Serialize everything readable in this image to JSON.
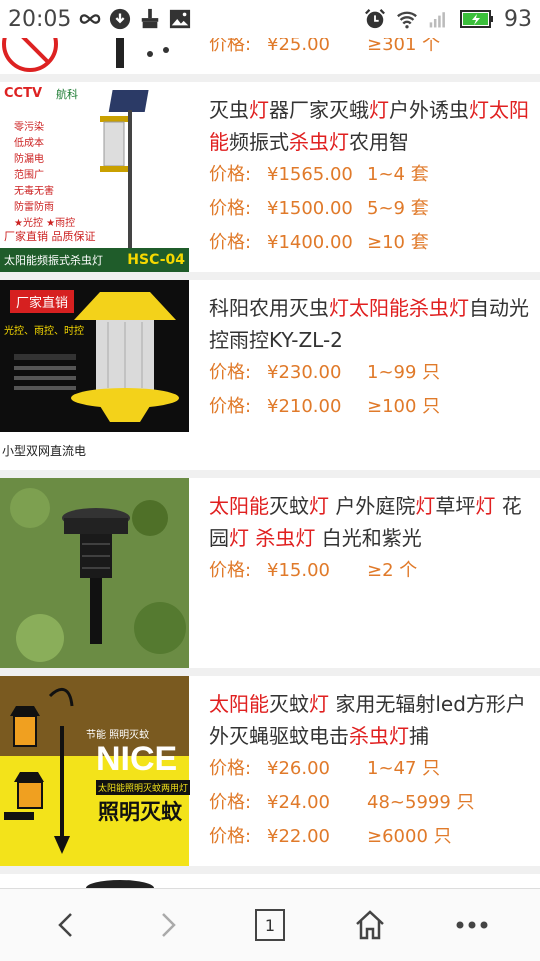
{
  "status": {
    "time": "20:05",
    "battery": "93"
  },
  "items": [
    {
      "title_parts": [],
      "prices": [
        {
          "label": "价格:",
          "amount": "¥25.00",
          "qty": "≥301 个"
        }
      ],
      "thumb_caption": ""
    },
    {
      "title_parts": [
        {
          "t": "灭虫",
          "hl": false
        },
        {
          "t": "灯",
          "hl": true
        },
        {
          "t": "器厂家灭蛾",
          "hl": false
        },
        {
          "t": "灯",
          "hl": true
        },
        {
          "t": "户外诱虫",
          "hl": false
        },
        {
          "t": "灯太阳能",
          "hl": true
        },
        {
          "t": "频振式",
          "hl": false
        },
        {
          "t": "杀虫灯",
          "hl": true
        },
        {
          "t": "农用智",
          "hl": false
        }
      ],
      "prices": [
        {
          "label": "价格:",
          "amount": "¥1565.00",
          "qty": "1~4 套"
        },
        {
          "label": "价格:",
          "amount": "¥1500.00",
          "qty": "5~9 套"
        },
        {
          "label": "价格:",
          "amount": "¥1400.00",
          "qty": "≥10 套"
        }
      ],
      "thumb_brand": "CCTV",
      "thumb_brand2": "航科",
      "thumb_caption": "太阳能频振式杀虫灯",
      "thumb_model": "HSC-04",
      "thumb_bottom": "厂家直销 品质保证",
      "thumb_features": [
        "零污染",
        "低成本",
        "防漏电",
        "范围广",
        "无毒无害",
        "防雷防雨",
        "★光控 ★雨控"
      ]
    },
    {
      "title_parts": [
        {
          "t": "科阳农用灭虫",
          "hl": false
        },
        {
          "t": "灯太阳能杀虫灯",
          "hl": true
        },
        {
          "t": "自动光控雨控KY-ZL-2",
          "hl": false
        }
      ],
      "prices": [
        {
          "label": "价格:",
          "amount": "¥230.00",
          "qty": "1~99 只"
        },
        {
          "label": "价格:",
          "amount": "¥210.00",
          "qty": "≥100 只"
        }
      ],
      "thumb_badge": "厂家直销",
      "thumb_tags": "光控、雨控、时控",
      "thumb_caption": "小型双网直流电"
    },
    {
      "title_parts": [
        {
          "t": "太阳能",
          "hl": true
        },
        {
          "t": "灭蚊",
          "hl": false
        },
        {
          "t": "灯",
          "hl": true
        },
        {
          "t": " 户外庭院",
          "hl": false
        },
        {
          "t": "灯",
          "hl": true
        },
        {
          "t": "草坪",
          "hl": false
        },
        {
          "t": "灯",
          "hl": true
        },
        {
          "t": " 花园",
          "hl": false
        },
        {
          "t": "灯",
          "hl": true
        },
        {
          "t": " ",
          "hl": false
        },
        {
          "t": "杀虫灯",
          "hl": true
        },
        {
          "t": " 白光和紫光",
          "hl": false
        }
      ],
      "prices": [
        {
          "label": "价格:",
          "amount": "¥15.00",
          "qty": "≥2 个"
        }
      ]
    },
    {
      "title_parts": [
        {
          "t": "太阳能",
          "hl": true
        },
        {
          "t": "灭蚊",
          "hl": false
        },
        {
          "t": "灯",
          "hl": true
        },
        {
          "t": " 家用无辐射led方形户外灭蝇驱蚊电击",
          "hl": false
        },
        {
          "t": "杀虫灯",
          "hl": true
        },
        {
          "t": "捕",
          "hl": false
        }
      ],
      "prices": [
        {
          "label": "价格:",
          "amount": "¥26.00",
          "qty": "1~47 只"
        },
        {
          "label": "价格:",
          "amount": "¥24.00",
          "qty": "48~5999 只"
        },
        {
          "label": "价格:",
          "amount": "¥22.00",
          "qty": "≥6000 只"
        }
      ],
      "thumb_nice": "NICE",
      "thumb_sub": "太阳能照明灭蚊两用灯",
      "thumb_big": "照明灭蚊",
      "thumb_top": "节能  照明灭蚊"
    }
  ],
  "bottom": {
    "tab_count": "1"
  },
  "colors": {
    "accent_red": "#e02020",
    "price_orange": "#e07a2a"
  }
}
